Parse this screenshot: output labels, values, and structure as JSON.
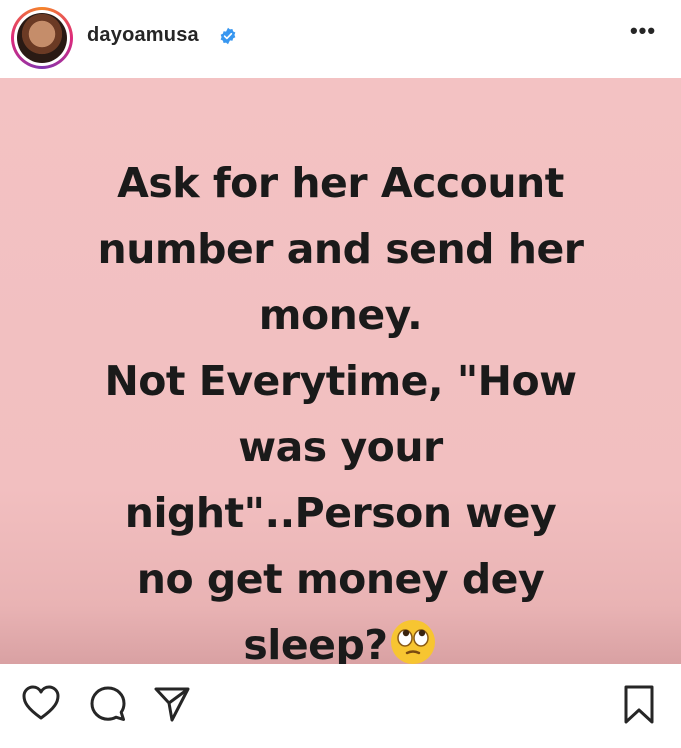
{
  "header": {
    "username": "dayoamusa",
    "verified_color": "#3897f0",
    "more_label": "•••",
    "avatar_icon": "profile-avatar"
  },
  "post": {
    "background_color": "#f2bfc0",
    "lines": [
      "Ask for her Account",
      "number and send her",
      "money.",
      "Not Everytime, \"How",
      "was your",
      "night\"..Person wey",
      "no get money dey",
      "sleep?"
    ],
    "emoji": "face-with-rolling-eyes"
  },
  "actions": {
    "like_icon": "heart-icon",
    "comment_icon": "comment-icon",
    "share_icon": "paper-plane-icon",
    "save_icon": "bookmark-icon"
  }
}
